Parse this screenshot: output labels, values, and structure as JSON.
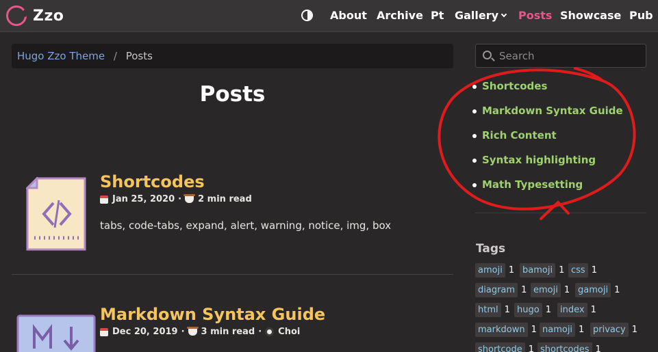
{
  "nav": {
    "logo_text": "Zzo",
    "items": [
      {
        "label": "About"
      },
      {
        "label": "Archive"
      },
      {
        "label": "Pt"
      },
      {
        "label": "Gallery"
      },
      {
        "label": "Posts",
        "active": true
      },
      {
        "label": "Showcase"
      },
      {
        "label": "Pub"
      }
    ]
  },
  "breadcrumb": {
    "home": "Hugo Zzo Theme",
    "separator": "/",
    "current": "Posts"
  },
  "page_title": "Posts",
  "posts": [
    {
      "title": "Shortcodes",
      "date": "Jan 25, 2020",
      "read_time": "2 min read",
      "summary": "tabs, code-tabs, expand, alert, warning, notice, img, box"
    },
    {
      "title": "Markdown Syntax Guide",
      "date": "Dec 20, 2019",
      "read_time": "3 min read",
      "author": "Choi"
    }
  ],
  "search": {
    "placeholder": "Search"
  },
  "toc": [
    "Shortcodes",
    "Markdown Syntax Guide",
    "Rich Content",
    "Syntax highlighting",
    "Math Typesetting"
  ],
  "tags": {
    "title": "Tags",
    "items": [
      {
        "name": "amoji",
        "count": "1"
      },
      {
        "name": "bamoji",
        "count": "1"
      },
      {
        "name": "css",
        "count": "1"
      },
      {
        "name": "diagram",
        "count": "1"
      },
      {
        "name": "emoji",
        "count": "1"
      },
      {
        "name": "gamoji",
        "count": "1"
      },
      {
        "name": "html",
        "count": "1"
      },
      {
        "name": "hugo",
        "count": "1"
      },
      {
        "name": "index",
        "count": "1"
      },
      {
        "name": "markdown",
        "count": "1"
      },
      {
        "name": "namoji",
        "count": "1"
      },
      {
        "name": "privacy",
        "count": "1"
      },
      {
        "name": "shortcode",
        "count": "1"
      },
      {
        "name": "shortcodes",
        "count": "1"
      }
    ]
  },
  "colors": {
    "accent": "#e8568a",
    "post_title": "#f5c55b",
    "toc_link": "#9fd26e",
    "tag_link": "#8ecae6",
    "annotation": "#e01b1b"
  }
}
